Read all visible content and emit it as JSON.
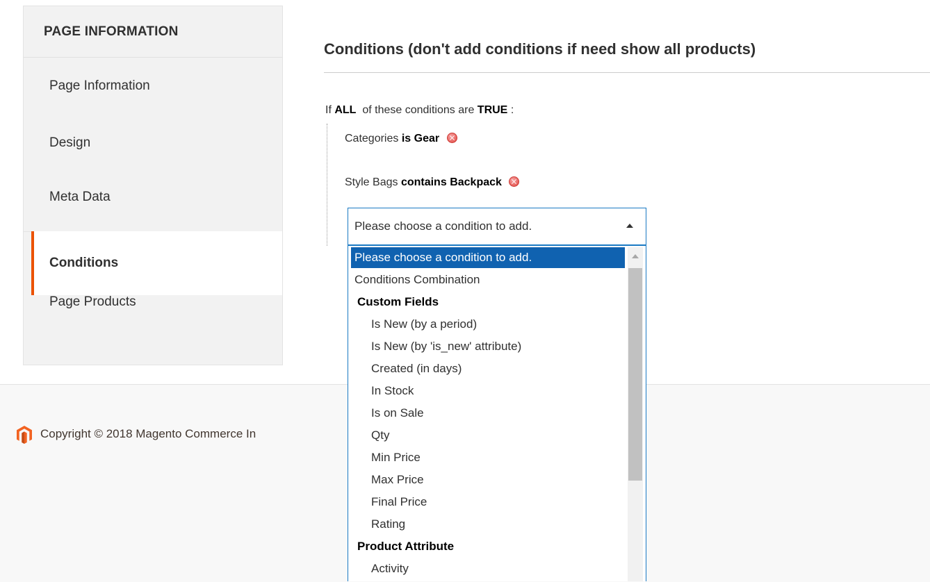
{
  "sidebar": {
    "title": "PAGE INFORMATION",
    "items": [
      {
        "label": "Page Information"
      },
      {
        "label": "Design"
      },
      {
        "label": "Meta Data"
      },
      {
        "label": "Conditions",
        "active": true
      },
      {
        "label": "Page Products"
      }
    ]
  },
  "main": {
    "heading": "Conditions (don't add conditions if need show all products)",
    "rule": {
      "prefix": "If",
      "aggregator": "ALL",
      "middle": "of these conditions are",
      "value": "TRUE",
      "suffix": ":"
    },
    "conditions": [
      {
        "attribute": "Categories",
        "operator": "is",
        "value": "Gear"
      },
      {
        "attribute": "Style Bags",
        "operator": "contains",
        "value": "Backpack"
      }
    ],
    "select": {
      "value": "Please choose a condition to add."
    },
    "options": [
      {
        "label": "Please choose a condition to add.",
        "kind": "selected"
      },
      {
        "label": "Conditions Combination",
        "kind": "lvl1"
      },
      {
        "label": "Custom Fields",
        "kind": "group"
      },
      {
        "label": "Is New (by a period)",
        "kind": "lvl2"
      },
      {
        "label": "Is New (by 'is_new' attribute)",
        "kind": "lvl2"
      },
      {
        "label": "Created (in days)",
        "kind": "lvl2"
      },
      {
        "label": "In Stock",
        "kind": "lvl2"
      },
      {
        "label": "Is on Sale",
        "kind": "lvl2"
      },
      {
        "label": "Qty",
        "kind": "lvl2"
      },
      {
        "label": "Min Price",
        "kind": "lvl2"
      },
      {
        "label": "Max Price",
        "kind": "lvl2"
      },
      {
        "label": "Final Price",
        "kind": "lvl2"
      },
      {
        "label": "Rating",
        "kind": "lvl2"
      },
      {
        "label": "Product Attribute",
        "kind": "group"
      },
      {
        "label": "Activity",
        "kind": "lvl2"
      }
    ]
  },
  "footer": {
    "copyright": "Copyright © 2018 Magento Commerce In"
  },
  "colors": {
    "accent": "#eb5202",
    "selection": "#1062b0",
    "focus_border": "#1979c3",
    "remove_icon": "#e0443e"
  }
}
